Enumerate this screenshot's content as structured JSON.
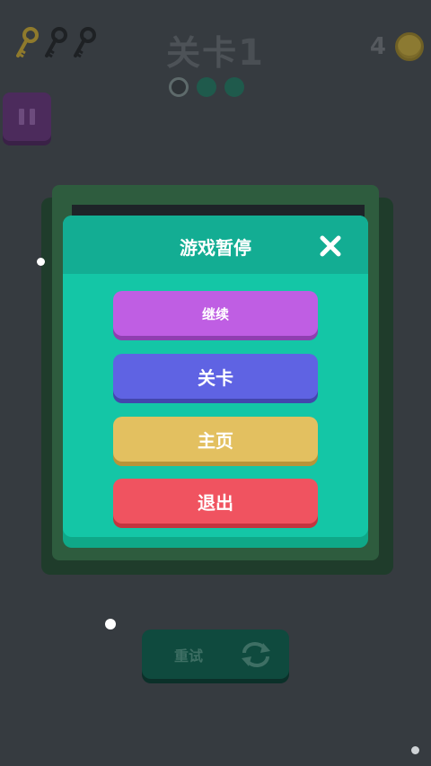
{
  "hud": {
    "level_prefix": "关卡",
    "level_number": "1",
    "keys": [
      {
        "icon": "key-icon",
        "collected": true,
        "color": "#8f7a2c"
      },
      {
        "icon": "key-icon",
        "collected": false,
        "color": "#1e2124"
      },
      {
        "icon": "key-icon",
        "collected": false,
        "color": "#1e2124"
      }
    ],
    "stage_progress": [
      "current",
      "todo",
      "todo"
    ],
    "coin_count": "4",
    "coin_icon": "coin-icon"
  },
  "pause_button": {
    "icon": "pause-icon"
  },
  "pause_dialog": {
    "title": "游戏暂停",
    "close_icon": "close-icon",
    "buttons": {
      "continue": "继续",
      "levels": "关卡",
      "home": "主页",
      "quit": "退出"
    }
  },
  "retry": {
    "label": "重试",
    "icon": "retry-icon"
  },
  "colors": {
    "background": "#363b40",
    "dialog": "#14c6a6",
    "continue": "#bf5ee3",
    "levels": "#5f63e3",
    "home": "#e3c060",
    "quit": "#f05360"
  }
}
